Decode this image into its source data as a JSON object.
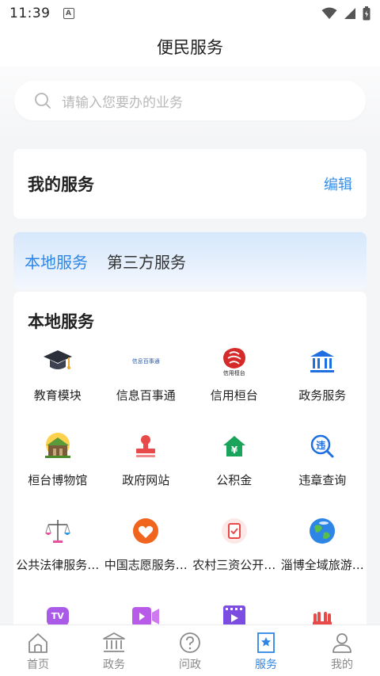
{
  "status": {
    "time": "11:39",
    "a_badge": "A"
  },
  "header": {
    "title": "便民服务"
  },
  "search": {
    "placeholder": "请输入您要办的业务"
  },
  "my_services": {
    "title": "我的服务",
    "edit_label": "编辑"
  },
  "tabs": [
    {
      "label": "本地服务",
      "active": true
    },
    {
      "label": "第三方服务",
      "active": false
    }
  ],
  "local_services": {
    "title": "本地服务",
    "items": [
      {
        "label": "教育模块",
        "icon": "graduation-cap-icon"
      },
      {
        "label": "信息百事通",
        "icon": "info-banner-icon",
        "icon_text": "信息百事通"
      },
      {
        "label": "信用桓台",
        "icon": "credit-logo-icon",
        "icon_text": "信用桓台"
      },
      {
        "label": "政务服务",
        "icon": "government-building-icon"
      },
      {
        "label": "桓台博物馆",
        "icon": "museum-icon"
      },
      {
        "label": "政府网站",
        "icon": "stamp-icon"
      },
      {
        "label": "公积金",
        "icon": "house-yen-icon"
      },
      {
        "label": "违章查询",
        "icon": "violation-search-icon",
        "icon_text": "违"
      },
      {
        "label": "公共法律服务…",
        "icon": "scales-icon"
      },
      {
        "label": "中国志愿服务…",
        "icon": "volunteer-heart-icon"
      },
      {
        "label": "农村三资公开…",
        "icon": "checklist-icon"
      },
      {
        "label": "淄博全域旅游…",
        "icon": "globe-icon"
      },
      {
        "label": "",
        "icon": "tv-icon",
        "icon_text": "TV"
      },
      {
        "label": "",
        "icon": "video-camera-icon"
      },
      {
        "label": "",
        "icon": "film-icon"
      },
      {
        "label": "",
        "icon": "hands-icon"
      }
    ]
  },
  "bottom_nav": [
    {
      "label": "首页",
      "icon": "home-icon",
      "active": false
    },
    {
      "label": "政务",
      "icon": "building-icon",
      "active": false
    },
    {
      "label": "问政",
      "icon": "question-icon",
      "active": false
    },
    {
      "label": "服务",
      "icon": "star-bookmark-icon",
      "active": true
    },
    {
      "label": "我的",
      "icon": "user-icon",
      "active": false
    }
  ],
  "colors": {
    "accent": "#2d86e6",
    "edit": "#3a8ee6",
    "text": "#222222"
  }
}
